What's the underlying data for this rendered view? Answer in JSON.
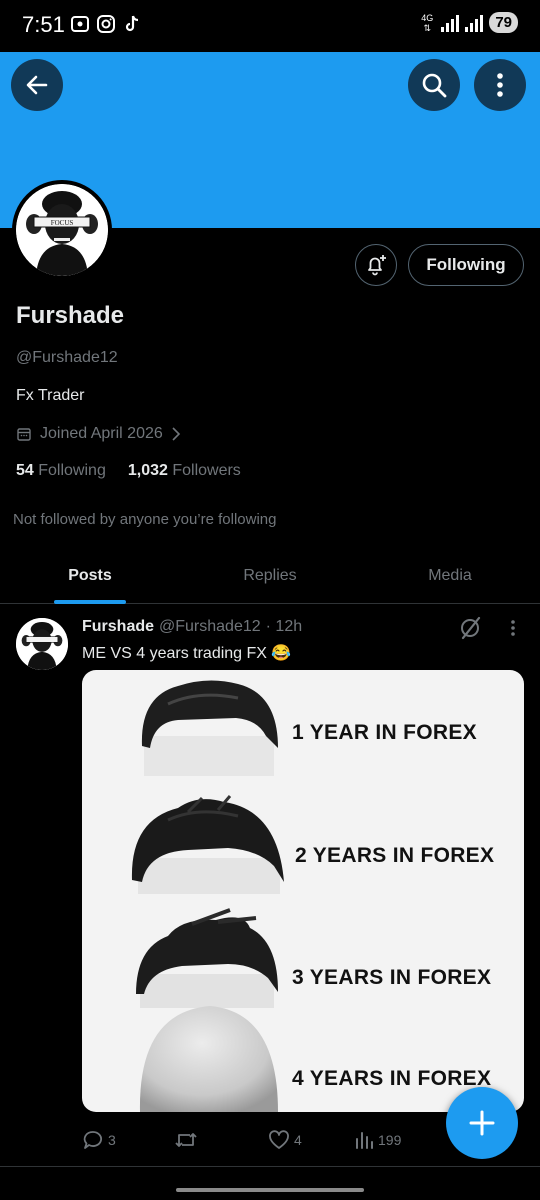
{
  "status_bar": {
    "time": "7:51",
    "network": "4G",
    "battery": "79"
  },
  "profile": {
    "name": "Furshade",
    "handle": "@Furshade12",
    "bio": "Fx Trader",
    "joined": "Joined April 2026",
    "following_count": "54",
    "following_label": "Following",
    "followers_count": "1,032",
    "followers_label": "Followers",
    "not_followed_text": "Not followed by anyone you’re following",
    "following_button": "Following",
    "avatar_text": "FOCUS"
  },
  "tabs": [
    {
      "label": "Posts",
      "active": true
    },
    {
      "label": "Replies",
      "active": false
    },
    {
      "label": "Media",
      "active": false
    }
  ],
  "post": {
    "author": "Furshade",
    "handle": "@Furshade12",
    "time": "· 12h",
    "text": "ME VS 4 years trading FX 😂",
    "media_labels": [
      "1 YEAR IN FOREX",
      "2 YEARS IN FOREX",
      "3 YEARS IN FOREX",
      "4 YEARS IN FOREX"
    ],
    "replies": "3",
    "retweets": "",
    "likes": "4",
    "views": "199"
  },
  "colors": {
    "accent": "#1d9bf0",
    "background": "#000000",
    "muted_text": "#71767b",
    "primary_text": "#e7e9ea",
    "border": "#2f3336"
  },
  "icons": {
    "back": "arrow-left-icon",
    "search": "search-icon",
    "more": "more-vertical-icon",
    "notify": "bell-plus-icon",
    "calendar": "calendar-icon",
    "grok": "grok-icon",
    "reply": "reply-icon",
    "retweet": "retweet-icon",
    "like": "heart-icon",
    "views": "views-icon",
    "compose": "plus-icon"
  }
}
